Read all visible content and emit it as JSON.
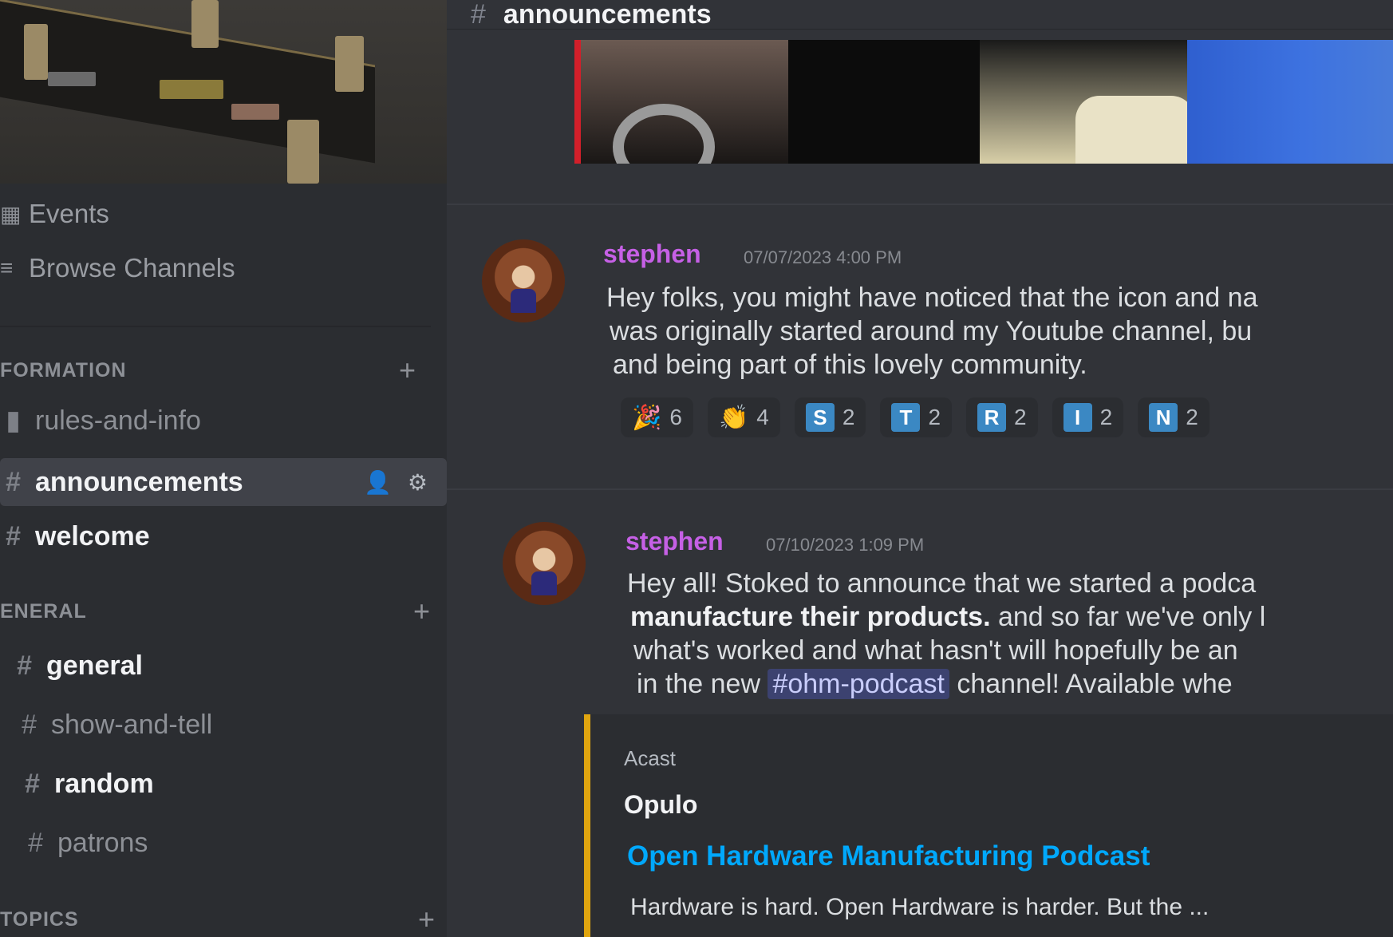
{
  "sidebar": {
    "nav": [
      {
        "label": "Events",
        "icon": "calendar-icon"
      },
      {
        "label": "Browse Channels",
        "icon": "browse-icon"
      }
    ],
    "categories": [
      {
        "label": "FORMATION",
        "channels": [
          {
            "name": "rules-and-info",
            "state": "muted"
          },
          {
            "name": "announcements",
            "state": "selected"
          },
          {
            "name": "welcome",
            "state": "unread"
          }
        ]
      },
      {
        "label": "ENERAL",
        "channels": [
          {
            "name": "general",
            "state": "unread"
          },
          {
            "name": "show-and-tell",
            "state": "muted"
          },
          {
            "name": "random",
            "state": "unread"
          },
          {
            "name": "patrons",
            "state": "muted"
          }
        ]
      },
      {
        "label": "TOPICS",
        "channels": []
      }
    ]
  },
  "header": {
    "channel": "announcements"
  },
  "messages": [
    {
      "author": "stephen",
      "timestamp": "07/07/2023 4:00 PM",
      "lines": [
        "Hey folks, you might have noticed that the icon and na",
        "was originally started around my Youtube channel, bu",
        "and being part of this lovely community."
      ],
      "reactions": [
        {
          "emoji": "🎉",
          "tile": "",
          "count": "6"
        },
        {
          "emoji": "👏",
          "tile": "",
          "count": "4"
        },
        {
          "emoji": "",
          "tile": "S",
          "count": "2"
        },
        {
          "emoji": "",
          "tile": "T",
          "count": "2"
        },
        {
          "emoji": "",
          "tile": "R",
          "count": "2"
        },
        {
          "emoji": "",
          "tile": "I",
          "count": "2"
        },
        {
          "emoji": "",
          "tile": "N",
          "count": "2"
        }
      ]
    },
    {
      "author": "stephen",
      "timestamp": "07/10/2023 1:09 PM",
      "line1": "Hey all! Stoked to announce that we started a podca",
      "line2_bold": "manufacture their products.",
      "line2_rest": " and so far we've only l",
      "line3": "what's worked and what hasn't will hopefully be an",
      "line4_pre": "in the new ",
      "line4_mention": "#ohm-podcast",
      "line4_post": " channel! Available whe",
      "embed": {
        "provider": "Acast",
        "name": "Opulo",
        "title": "Open Hardware Manufacturing Podcast",
        "description": "Hardware is hard. Open Hardware is harder. But the ..."
      }
    }
  ],
  "colors": {
    "author": "#c660e6",
    "link": "#00a8fc",
    "embed_accent_red": "#d21f2a",
    "embed_accent_gold": "#e0a50f"
  }
}
